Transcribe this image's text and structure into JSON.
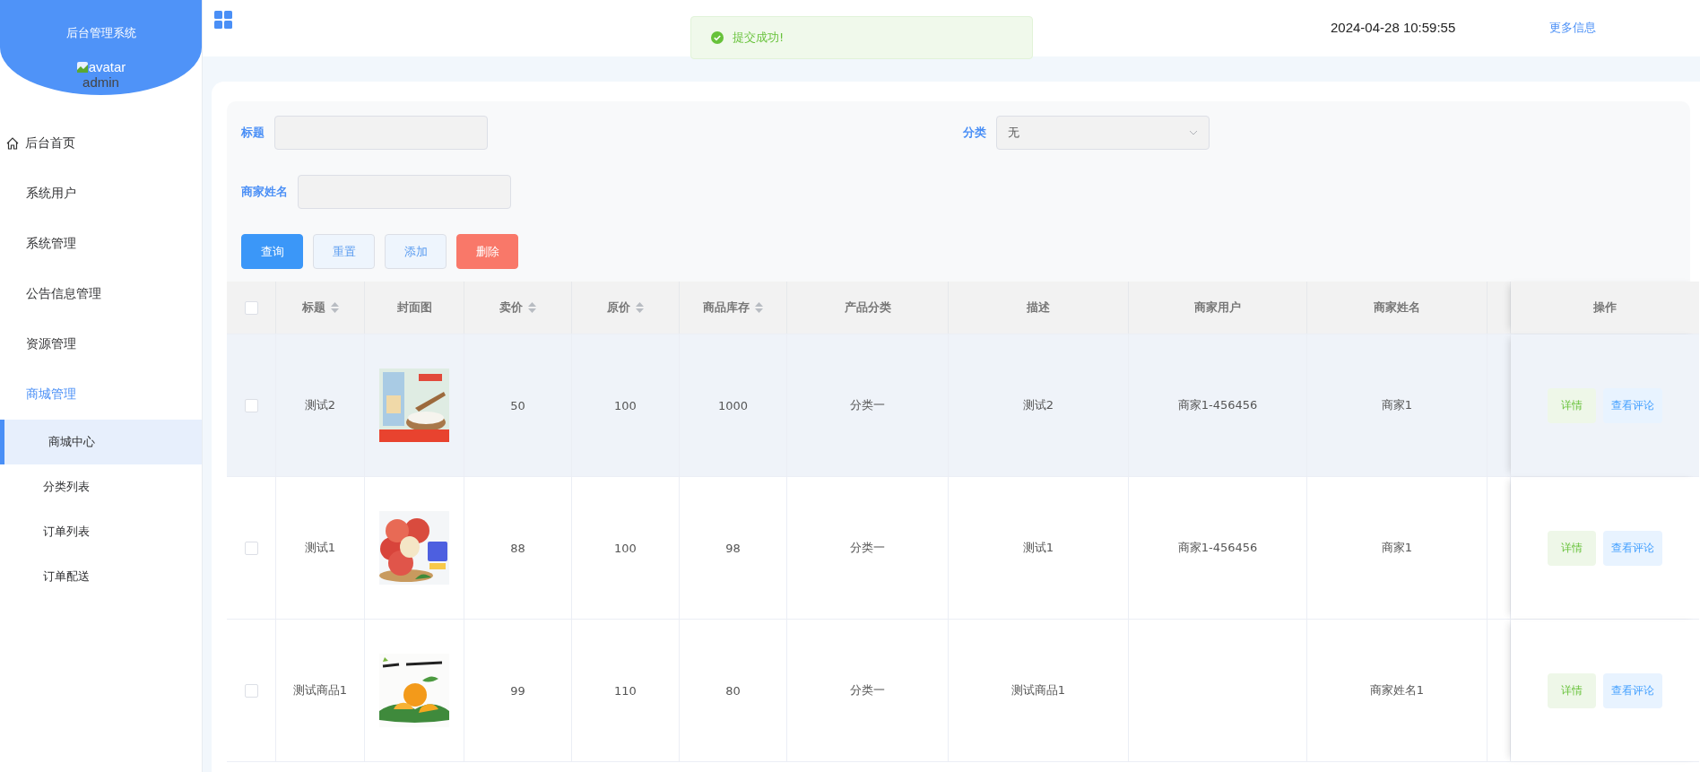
{
  "sidebar": {
    "title": "后台管理系统",
    "avatar_alt": "avatar",
    "username": "admin",
    "items": [
      {
        "label": "后台首页",
        "kind": "home",
        "selected": false
      },
      {
        "label": "系统用户",
        "kind": "group",
        "selected": false
      },
      {
        "label": "系统管理",
        "kind": "group",
        "selected": false
      },
      {
        "label": "公告信息管理",
        "kind": "group",
        "selected": false
      },
      {
        "label": "资源管理",
        "kind": "group",
        "selected": false
      },
      {
        "label": "商城管理",
        "kind": "group",
        "selected": true,
        "children": [
          {
            "label": "商城中心",
            "selected": true
          },
          {
            "label": "分类列表",
            "selected": false
          },
          {
            "label": "订单列表",
            "selected": false
          },
          {
            "label": "订单配送",
            "selected": false
          }
        ]
      }
    ]
  },
  "header": {
    "datetime": "2024-04-28 10:59:55",
    "more_link": "更多信息"
  },
  "toast": {
    "message": "提交成功!",
    "kind": "success"
  },
  "filters": {
    "fields": [
      {
        "label": "标题",
        "kind": "input"
      },
      {
        "label": "分类",
        "kind": "select",
        "value": "无"
      },
      {
        "label": "商家姓名",
        "kind": "input"
      }
    ],
    "buttons": [
      {
        "label": "查询",
        "kind": "primary"
      },
      {
        "label": "重置",
        "kind": "plain"
      },
      {
        "label": "添加",
        "kind": "plain"
      },
      {
        "label": "删除",
        "kind": "danger"
      }
    ]
  },
  "table": {
    "select_all_checked": false,
    "columns": [
      {
        "label": "标题",
        "sortable": true
      },
      {
        "label": "封面图",
        "sortable": false
      },
      {
        "label": "卖价",
        "sortable": true
      },
      {
        "label": "原价",
        "sortable": true
      },
      {
        "label": "商品库存",
        "sortable": true
      },
      {
        "label": "产品分类",
        "sortable": false
      },
      {
        "label": "描述",
        "sortable": false
      },
      {
        "label": "商家用户",
        "sortable": false
      },
      {
        "label": "商家姓名",
        "sortable": false
      },
      {
        "label": "操作",
        "sortable": false
      }
    ],
    "rows": [
      {
        "checked": false,
        "selected": true,
        "title": "测试2",
        "cover": {
          "kind": "picture"
        },
        "price": "50",
        "original_price": "100",
        "stock": "1000",
        "category": "分类一",
        "description": "测试2",
        "merchant_user": "商家1-456456",
        "merchant_name": "商家1",
        "actions": [
          "详情",
          "查看评论"
        ]
      },
      {
        "checked": false,
        "selected": false,
        "title": "测试1",
        "cover": {
          "kind": "picture"
        },
        "price": "88",
        "original_price": "100",
        "stock": "98",
        "category": "分类一",
        "description": "测试1",
        "merchant_user": "商家1-456456",
        "merchant_name": "商家1",
        "actions": [
          "详情",
          "查看评论"
        ]
      },
      {
        "checked": false,
        "selected": false,
        "title": "测试商品1",
        "cover": {
          "kind": "picture"
        },
        "price": "99",
        "original_price": "110",
        "stock": "80",
        "category": "分类一",
        "description": "测试商品1",
        "merchant_name": "商家姓名1",
        "actions": [
          "详情",
          "查看评论"
        ]
      }
    ]
  }
}
